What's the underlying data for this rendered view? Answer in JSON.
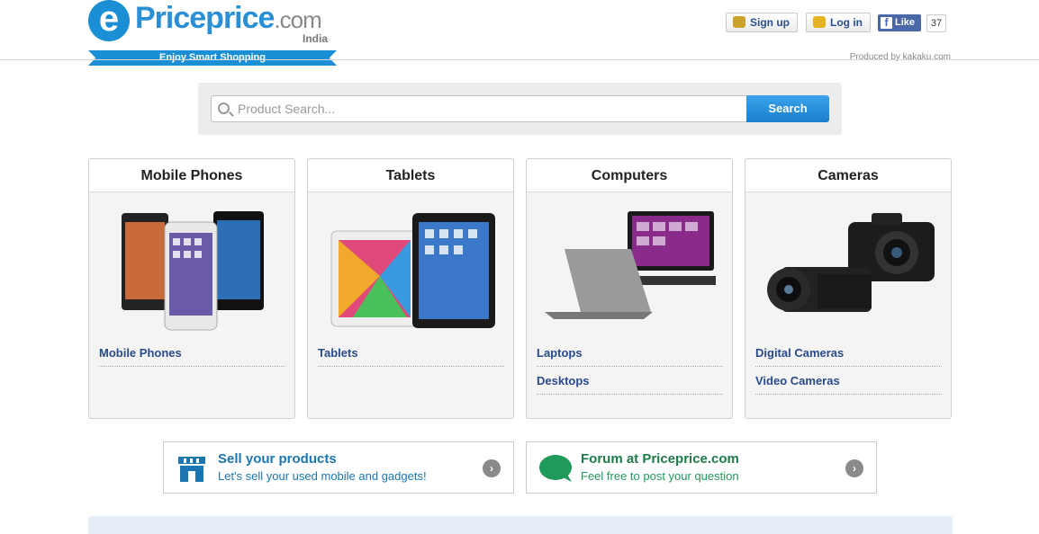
{
  "header": {
    "logo_glyph": "e",
    "logo_name": "Priceprice",
    "logo_domain": ".com",
    "logo_region": "India",
    "tagline": "Enjoy Smart Shopping",
    "signup_label": "Sign up",
    "login_label": "Log in",
    "fb_glyph": "f",
    "fb_like_label": "Like",
    "fb_like_count": "37",
    "produced_by": "Produced by kakaku.com"
  },
  "search": {
    "placeholder": "Product Search...",
    "button_label": "Search"
  },
  "categories": [
    {
      "title": "Mobile Phones",
      "links": [
        "Mobile Phones"
      ]
    },
    {
      "title": "Tablets",
      "links": [
        "Tablets"
      ]
    },
    {
      "title": "Computers",
      "links": [
        "Laptops",
        "Desktops"
      ]
    },
    {
      "title": "Cameras",
      "links": [
        "Digital Cameras",
        "Video Cameras"
      ]
    }
  ],
  "promos": [
    {
      "title": "Sell your products",
      "subtitle": "Let's sell your used mobile and gadgets!",
      "arrow": "›",
      "color": "#1b76b3"
    },
    {
      "title": "Forum at Priceprice.com",
      "subtitle": "Feel free to post your question",
      "arrow": "›",
      "color": "#1f9a5a"
    }
  ],
  "colors": {
    "brand": "#1a8fd6",
    "link": "#2a4a8a"
  }
}
